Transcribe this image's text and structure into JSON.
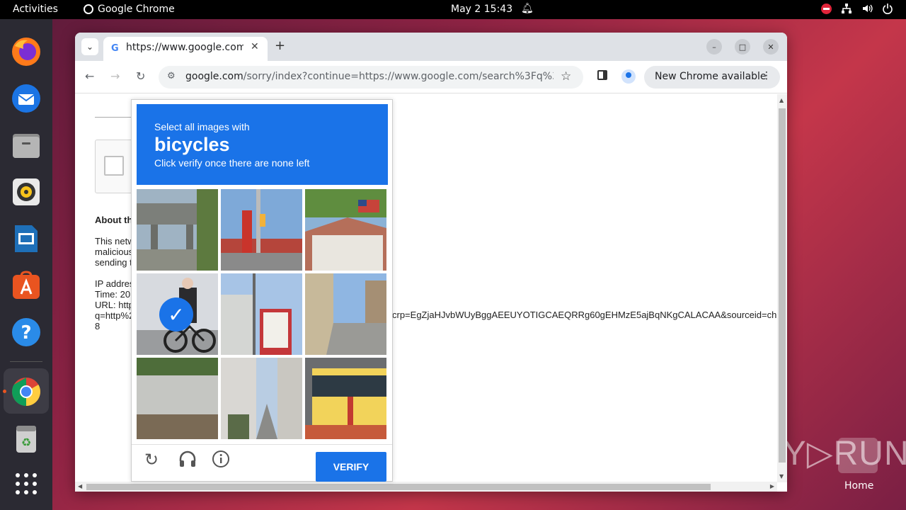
{
  "topbar": {
    "activities": "Activities",
    "app_name": "Google Chrome",
    "clock": "May 2  15:43"
  },
  "dock": {
    "items": [
      "firefox-icon",
      "thunderbird-icon",
      "files-icon",
      "rhythmbox-icon",
      "libreoffice-impress-icon",
      "app-center-icon",
      "help-icon",
      "chrome-icon",
      "trash-icon",
      "show-apps-icon"
    ]
  },
  "browser": {
    "tab_title": "https://www.google.com",
    "url_host": "google.com",
    "url_rest": "/sorry/index?continue=https://www.google.com/search%3Fq%3Dhtt...",
    "update_label": "New Chrome available"
  },
  "page": {
    "about": "About th",
    "para": [
      "This netw",
      "malicious",
      "sending t"
    ],
    "info": [
      "IP addres",
      "Time: 20",
      "URL: http",
      "q=http%2",
      "8"
    ],
    "url_trail": "crp=EgZjaHJvbWUyBggAEEUYOTIGCAEQRRg60gEHMzE5ajBqNKgCALACAA&sourceid=ch"
  },
  "captcha": {
    "line1": "Select all images with",
    "target": "bicycles",
    "line3": "Click verify once there are none left",
    "verify_label": "VERIFY",
    "tiles": [
      "overpass",
      "gas-station",
      "house-flag",
      "cyclist-selected",
      "vending-street",
      "street",
      "greenhouse",
      "narrow-street",
      "bus"
    ],
    "selected_index": 3
  },
  "desktop": {
    "watermark": "ANY▷RUN",
    "home_label": "Home"
  },
  "colors": {
    "accent": "#1a73e8",
    "ubuntu_orange": "#e95420"
  }
}
